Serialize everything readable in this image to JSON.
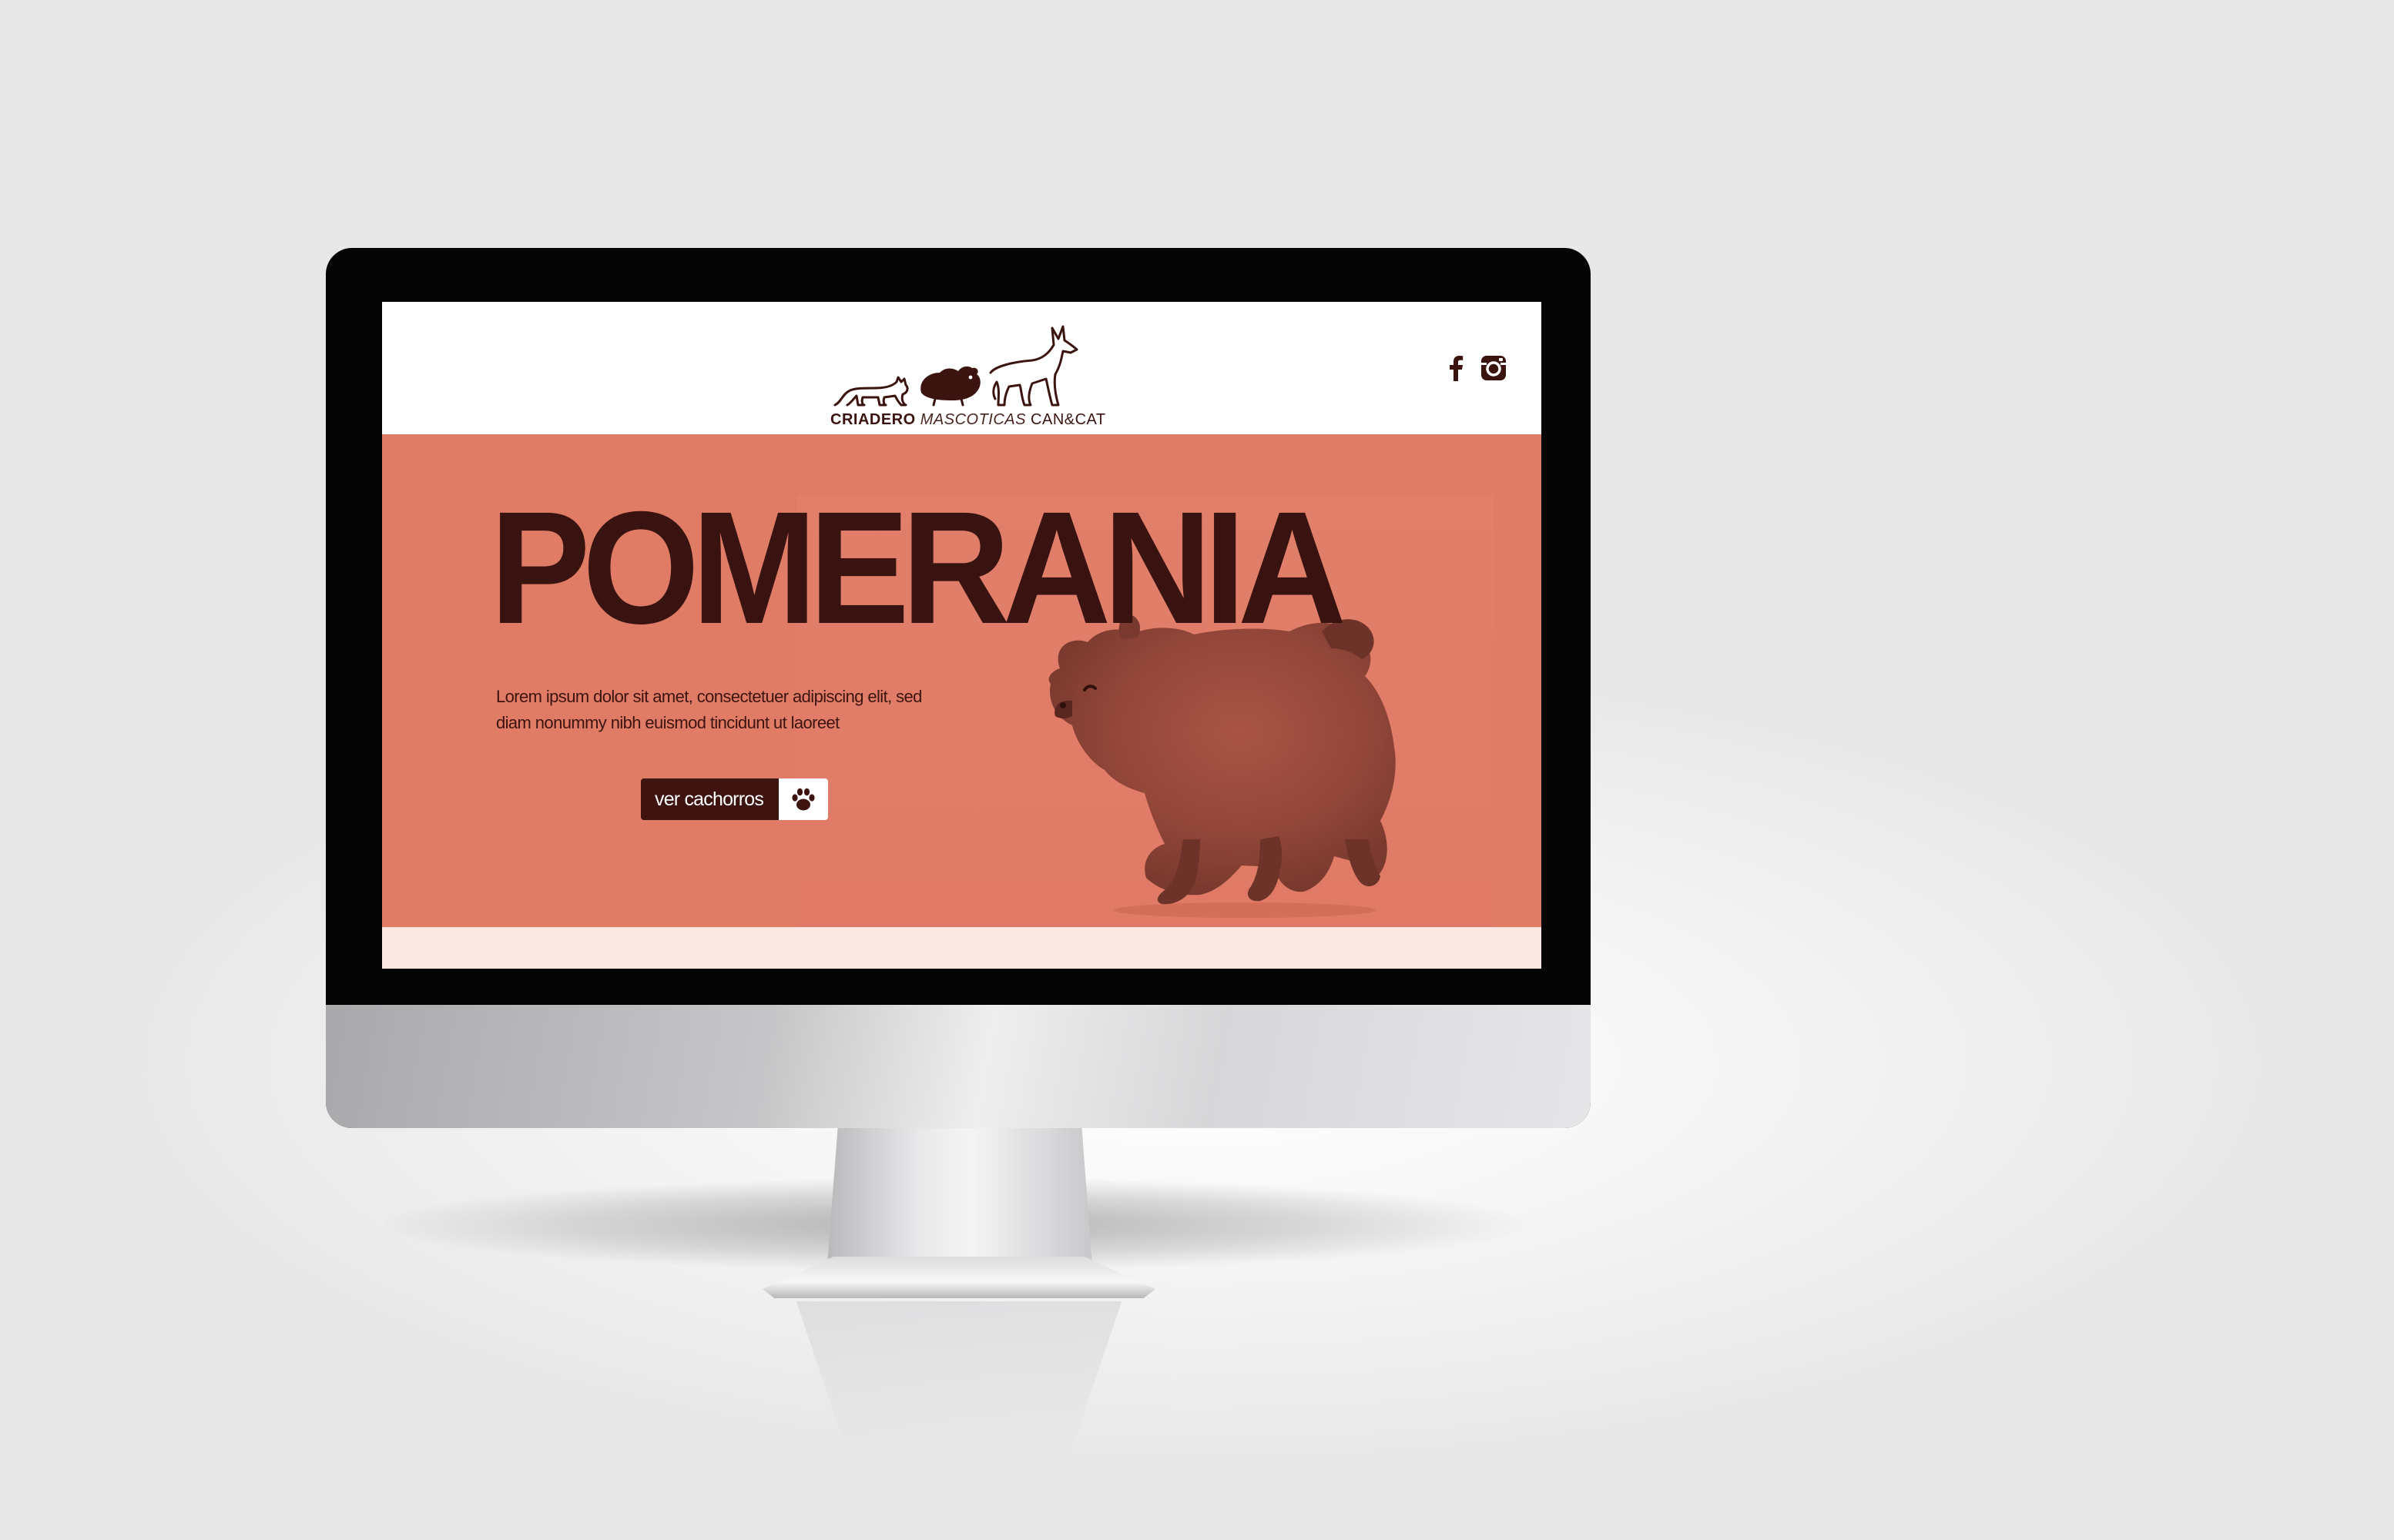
{
  "logo": {
    "icon_names": [
      "cat-icon",
      "guinea-pig-icon",
      "dog-icon"
    ],
    "word_criadero": "CRIADERO",
    "word_mascoticas": "MASCOTICAS",
    "word_cancat": "CAN&CAT"
  },
  "social": {
    "icons": [
      "facebook-icon",
      "instagram-icon"
    ]
  },
  "hero": {
    "title": "POMERANIA",
    "description": "Lorem ipsum dolor sit amet, consectetuer adipiscing elit, sed diam nonummy nibh euismod tincidunt ut laoreet",
    "cta_label": "ver cachorros",
    "cta_icon": "paw-icon"
  },
  "colors": {
    "hero_background": "#e07b66",
    "brand_dark": "#3d1410",
    "header_background": "#ffffff",
    "strip_background": "#fbe8e3"
  }
}
